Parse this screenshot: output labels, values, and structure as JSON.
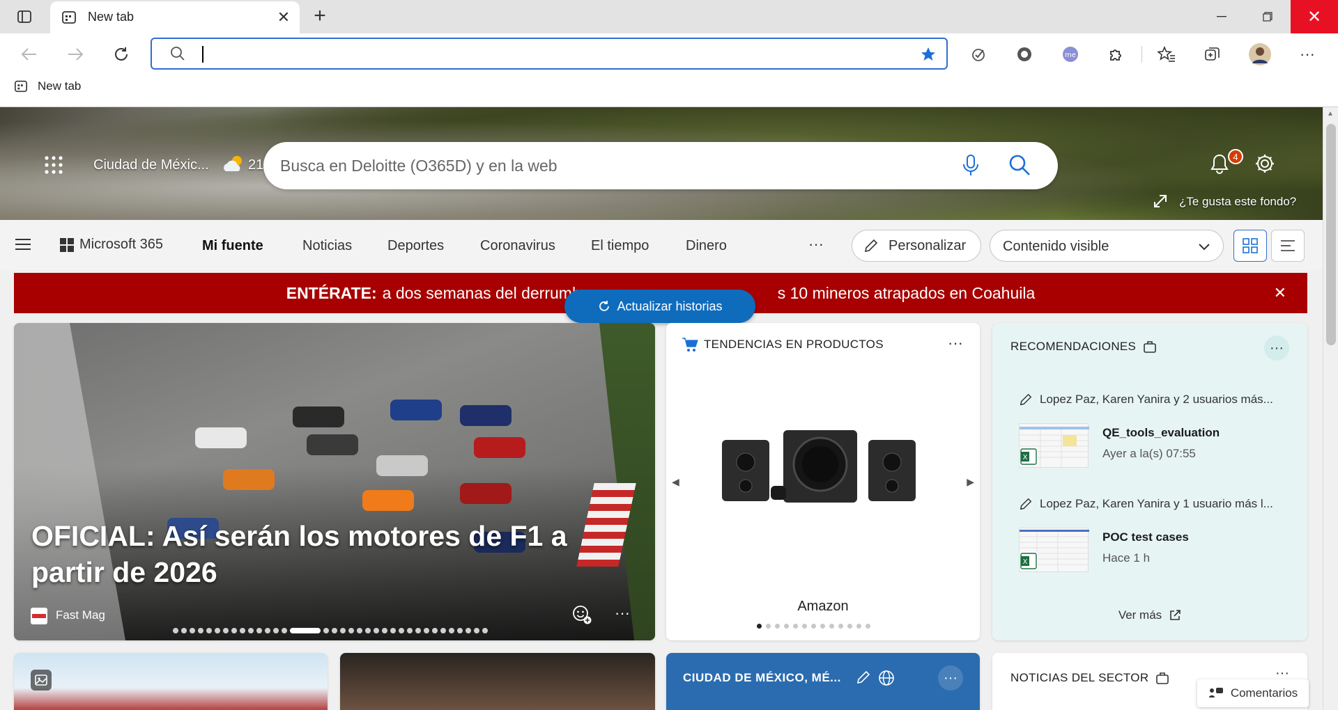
{
  "browser": {
    "tab_title": "New tab",
    "address_value": "",
    "favorites_bar": {
      "items": [
        {
          "label": "New tab"
        }
      ]
    },
    "profile_initial": "me"
  },
  "hero": {
    "location": "Ciudad de Méxic...",
    "temperature": "21",
    "search_placeholder": "Busca en Deloitte (O365D) y en la web",
    "notification_count": "4",
    "like_background": "¿Te gusta este fondo?"
  },
  "navbar": {
    "m365": "Microsoft 365",
    "links": [
      "Mi fuente",
      "Noticias",
      "Deportes",
      "Coronavirus",
      "El tiempo",
      "Dinero"
    ],
    "more": "···",
    "personalizar": "Personalizar",
    "contenido": "Contenido visible"
  },
  "banner": {
    "prefix": "ENTÉRATE:",
    "text": "a dos semanas del derrumbe... atrapados en Coahuila",
    "text_left": "a dos semanas del derrumb",
    "text_right": "s 10 mineros atrapados en Coahuila",
    "refresh": "Actualizar historias"
  },
  "hero_story": {
    "title": "OFICIAL: Así serán los motores de F1 a partir de 2026",
    "source": "Fast Mag",
    "more": "···",
    "slides": 35,
    "active_slide": 14
  },
  "products": {
    "header": "TENDENCIAS EN PRODUCTOS",
    "more": "···",
    "store": "Amazon",
    "slides": 13,
    "active_slide": 0
  },
  "recommendations": {
    "header": "RECOMENDACIONES",
    "more": "···",
    "items": [
      {
        "editors": "Lopez Paz, Karen Yanira y 2 usuarios más...",
        "file": "QE_tools_evaluation",
        "time": "Ayer a la(s) 07:55"
      },
      {
        "editors": "Lopez Paz, Karen Yanira y 1 usuario más l...",
        "file": "POC test cases",
        "time": "Hace 1 h"
      }
    ],
    "see_more": "Ver más"
  },
  "weather_card": {
    "title": "CIUDAD DE MÉXICO, MÉ...",
    "more": "···"
  },
  "sector_card": {
    "title": "NOTICIAS DEL SECTOR",
    "more": "···"
  },
  "feedback": "Comentarios",
  "colors": {
    "accent": "#0f6cbd",
    "banner": "#a80000",
    "close": "#e81123"
  }
}
